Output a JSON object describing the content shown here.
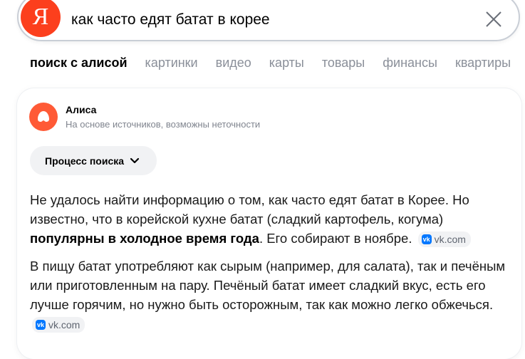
{
  "search": {
    "logo_letter": "Я",
    "query": "как часто едят батат в корее"
  },
  "tabs": [
    {
      "label": "поиск с алисой",
      "active": true
    },
    {
      "label": "картинки"
    },
    {
      "label": "видео"
    },
    {
      "label": "карты"
    },
    {
      "label": "товары"
    },
    {
      "label": "финансы"
    },
    {
      "label": "квартиры"
    }
  ],
  "answer": {
    "assistant_name": "Алиса",
    "disclaimer": "На основе источников, возможны неточности",
    "process_label": "Процесс поиска",
    "p1_text": "Не удалось найти информацию о том, как часто едят батат в Корее. Но известно, что в корейской кухне батат (сладкий картофель, когума) ",
    "p1_bold": "популярны в холодное время года",
    "p1_tail": ". Его собирают в ноябре.",
    "p1_source": "vk.com",
    "p2_text": "В пищу батат употребляют как сырым (например, для салата), так и печёным или приготовленным на пару. Печёный батат имеет сладкий вкус, есть его лучше горячим, но нужно быть осторожным, так как можно легко обжечься.",
    "p2_source": "vk.com"
  },
  "colors": {
    "yandex_red": "#fc3f1d",
    "alice_orange": "#ff5a36",
    "vk_blue": "#0077ff"
  }
}
